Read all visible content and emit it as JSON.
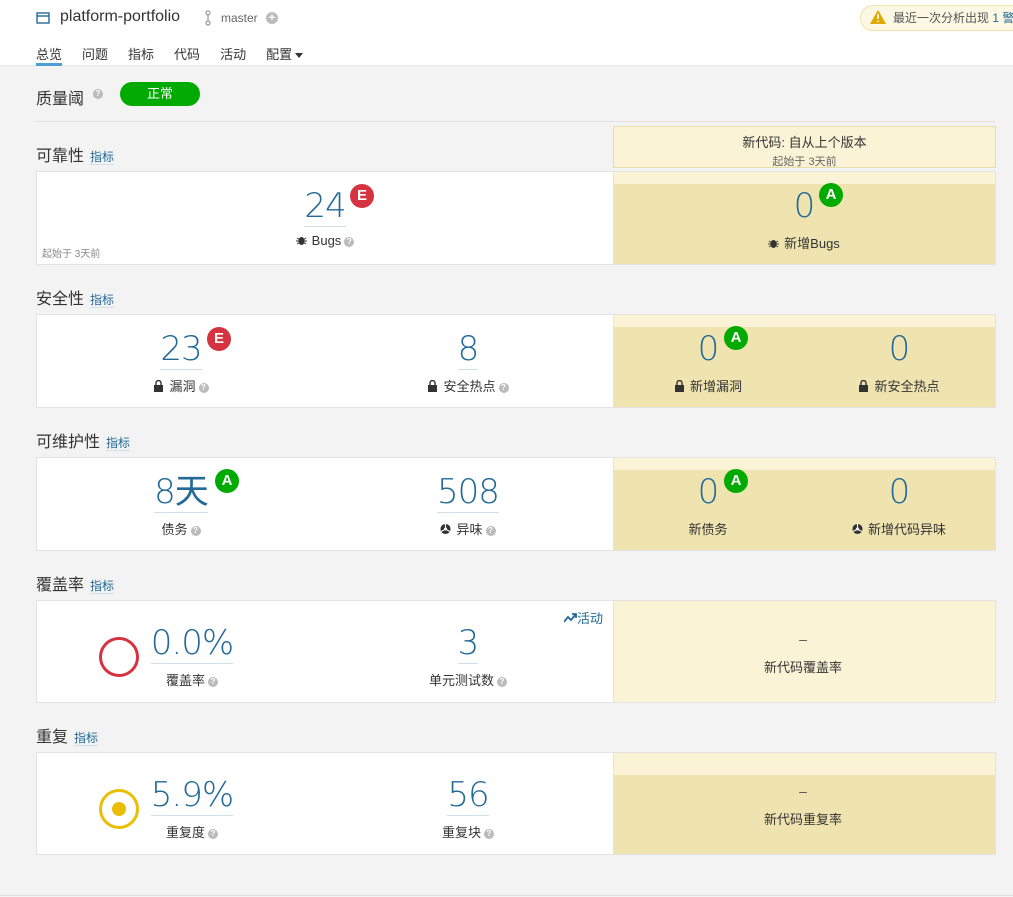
{
  "header": {
    "project_name": "platform-portfolio",
    "branch": "master",
    "branch_add": "+",
    "warning_text": "最近一次分析出现",
    "warning_count": "1",
    "warning_suffix": "警"
  },
  "nav": {
    "tabs": [
      "总览",
      "问题",
      "指标",
      "代码",
      "活动",
      "配置"
    ]
  },
  "quality_gate": {
    "label": "质量阈",
    "status": "正常",
    "help": "?"
  },
  "new_code": {
    "title": "新代码: 自从上个版本",
    "since": "起始于 3天前"
  },
  "sections": {
    "reliability": {
      "title": "可靠性",
      "link": "指标",
      "bugs_value": "24",
      "bugs_rating": "E",
      "bugs_label": "Bugs",
      "since": "起始于 3天前",
      "new_bugs_value": "0",
      "new_bugs_rating": "A",
      "new_bugs_label": "新增Bugs"
    },
    "security": {
      "title": "安全性",
      "link": "指标",
      "vuln_value": "23",
      "vuln_rating": "E",
      "vuln_label": "漏洞",
      "hotspot_value": "8",
      "hotspot_label": "安全热点",
      "new_vuln_value": "0",
      "new_vuln_rating": "A",
      "new_vuln_label": "新增漏洞",
      "new_hotspot_value": "0",
      "new_hotspot_label": "新安全热点"
    },
    "maintainability": {
      "title": "可维护性",
      "link": "指标",
      "debt_value": "8天",
      "debt_rating": "A",
      "debt_label": "债务",
      "smell_value": "508",
      "smell_label": "异味",
      "new_debt_value": "0",
      "new_debt_rating": "A",
      "new_debt_label": "新债务",
      "new_smell_value": "0",
      "new_smell_label": "新增代码异味"
    },
    "coverage": {
      "title": "覆盖率",
      "link": "指标",
      "activity": "活动",
      "coverage_value": "0.0%",
      "coverage_label": "覆盖率",
      "tests_value": "3",
      "tests_label": "单元测试数",
      "new_value": "–",
      "new_label": "新代码覆盖率"
    },
    "duplication": {
      "title": "重复",
      "link": "指标",
      "dup_value": "5.9%",
      "dup_label": "重复度",
      "blocks_value": "56",
      "blocks_label": "重复块",
      "new_value": "–",
      "new_label": "新代码重复率"
    }
  },
  "colors": {
    "accent": "#236a97",
    "rating_e": "#d4333f",
    "rating_a": "#00aa00",
    "new_code_bg": "#efe4b0",
    "coverage_circle": "#d4333f",
    "duplication_circle": "#eabe06"
  }
}
